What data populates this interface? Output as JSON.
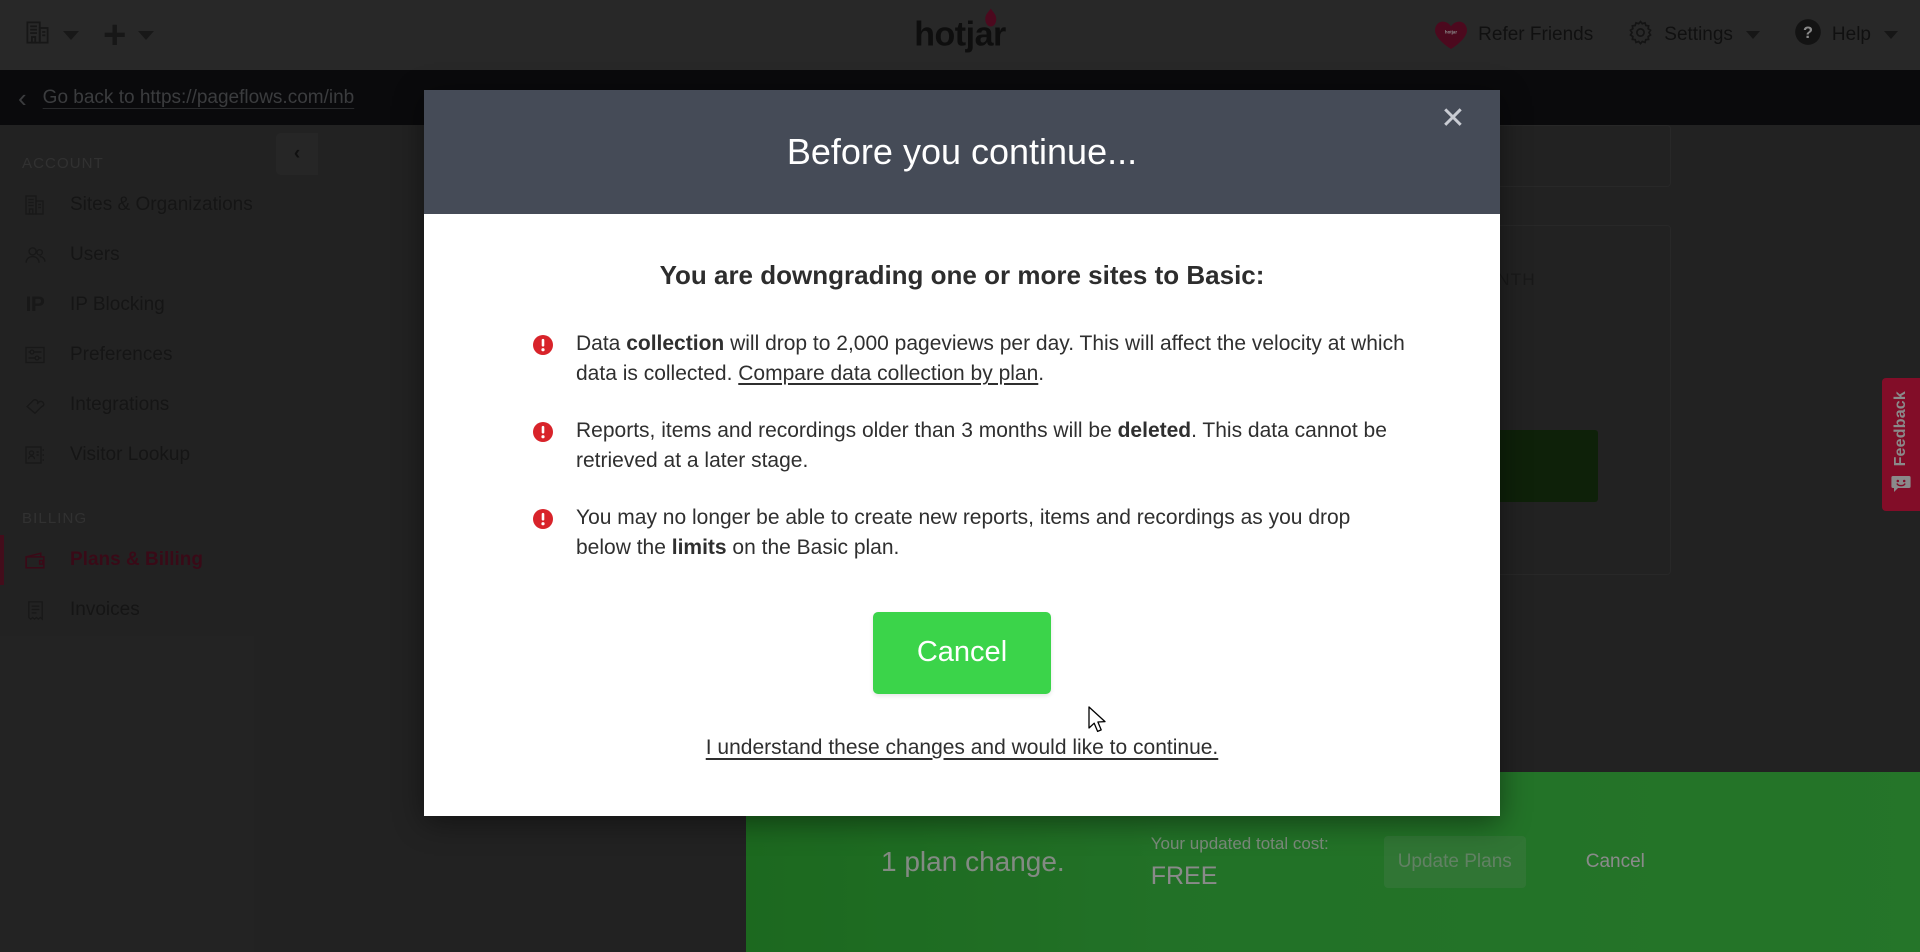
{
  "topbar": {
    "org_switcher_icon": "building-icon",
    "org_switcher_caret": "chevron-down-icon",
    "add_label": "+",
    "add_caret": "chevron-down-icon",
    "brand": "hotjar",
    "refer_friends": "Refer Friends",
    "settings": "Settings",
    "help": "Help"
  },
  "goback": {
    "chevron": "‹",
    "label": "Go back to https://pageflows.com/inb"
  },
  "sidebar": {
    "collapse_glyph": "‹",
    "groups": [
      {
        "label": "ACCOUNT",
        "items": [
          {
            "label": "Sites & Organizations",
            "icon": "building-icon",
            "active": false
          },
          {
            "label": "Users",
            "icon": "users-icon",
            "active": false
          },
          {
            "label": "IP Blocking",
            "icon": "ip-text-icon",
            "icon_text": "IP",
            "active": false
          },
          {
            "label": "Preferences",
            "icon": "sliders-icon",
            "active": false
          },
          {
            "label": "Integrations",
            "icon": "puzzle-icon",
            "active": false
          },
          {
            "label": "Visitor Lookup",
            "icon": "contact-card-icon",
            "active": false
          }
        ]
      },
      {
        "label": "BILLING",
        "items": [
          {
            "label": "Plans & Billing",
            "icon": "wallet-icon",
            "active": true
          },
          {
            "label": "Invoices",
            "icon": "invoice-icon",
            "active": false
          }
        ]
      }
    ]
  },
  "content": {
    "cost_month_header": "COST / MONTH"
  },
  "greenbar": {
    "plan_change": "1 plan change.",
    "cost_label": "Your updated total cost:",
    "cost_value": "FREE",
    "update_button": "Update Plans",
    "cancel_label": "Cancel"
  },
  "feedback": {
    "label": "Feedback",
    "icon": "smiley-speech-bubble-icon"
  },
  "modal": {
    "title": "Before you continue...",
    "close_glyph": "✕",
    "heading": "You are downgrading one or more sites to Basic:",
    "bullets": [
      {
        "icon": "exclamation-circle-icon",
        "parts": [
          {
            "t": "Data "
          },
          {
            "t": "collection",
            "bold": true
          },
          {
            "t": " will drop to 2,000 pageviews per day. This will affect the velocity at which data is collected. "
          },
          {
            "t": "Compare data collection by plan",
            "link": true
          },
          {
            "t": "."
          }
        ]
      },
      {
        "icon": "exclamation-circle-icon",
        "parts": [
          {
            "t": "Reports, items and recordings older than 3 months will be "
          },
          {
            "t": "deleted",
            "bold": true
          },
          {
            "t": ". This data cannot be retrieved at a later stage."
          }
        ]
      },
      {
        "icon": "exclamation-circle-icon",
        "parts": [
          {
            "t": "You may no longer be able to create new reports, items and recordings as you drop below the "
          },
          {
            "t": "limits",
            "bold": true
          },
          {
            "t": " on the Basic plan."
          }
        ]
      }
    ],
    "cancel_button": "Cancel",
    "continue_link": "I understand these changes and would like to continue."
  },
  "colors": {
    "brand_dark": "#1b1b1b",
    "accent_green": "#3bd44a",
    "warning_red": "#d8232a",
    "feedback_red": "#f0194a",
    "active_nav": "#7d1833",
    "modal_header": "#454b57"
  }
}
